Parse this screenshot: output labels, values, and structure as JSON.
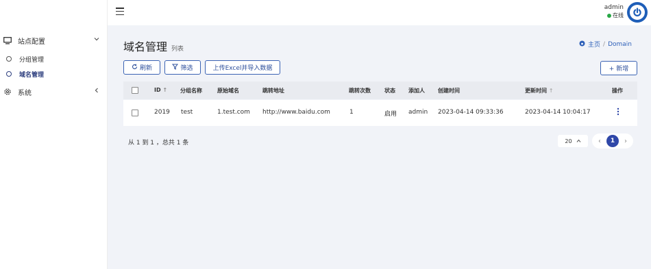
{
  "topbar": {
    "username": "admin",
    "status": "在线"
  },
  "sidebar": {
    "items": [
      {
        "label": "站点配置",
        "icon": "monitor-icon"
      },
      {
        "label": "系统",
        "icon": "gear-icon"
      }
    ],
    "subitems": [
      {
        "label": "分组管理",
        "active": false
      },
      {
        "label": "域名管理",
        "active": true
      }
    ]
  },
  "page": {
    "title": "域名管理",
    "subtitle": "列表",
    "breadcrumb": {
      "home": "主页",
      "current": "Domain"
    }
  },
  "toolbar": {
    "refresh": "刷新",
    "filter": "筛选",
    "upload": "上传Excel并导入数据",
    "add": "+ 新增"
  },
  "table": {
    "headers": {
      "id": "ID",
      "group": "分组名称",
      "origin": "原始域名",
      "target": "跳转地址",
      "count": "跳转次数",
      "state": "状态",
      "creator": "添加人",
      "created": "创建时间",
      "updated": "更新时间",
      "actions": "操作"
    },
    "rows": [
      {
        "id": "2019",
        "group": "test",
        "origin": "1.test.com",
        "target": "http://www.baidu.com",
        "count": "1",
        "state": "启用",
        "creator": "admin",
        "created": "2023-04-14 09:33:36",
        "updated": "2023-04-14 10:04:17"
      }
    ]
  },
  "footer": {
    "summary": "从 1 到 1 ，总共 1 条",
    "page_size": "20",
    "current_page": "1"
  },
  "colors": {
    "primary": "#2f47a8",
    "online": "#28a745",
    "link": "#2d5fb8"
  }
}
